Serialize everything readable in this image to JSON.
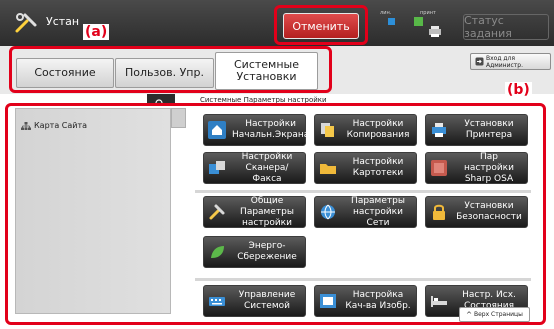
{
  "header": {
    "title": "Устан",
    "cancel_label": "Отменить",
    "status_label_1": "лин.",
    "status_label_2": "принт",
    "job_status_label": "Статус задания"
  },
  "tabs": [
    {
      "label": "Состояние",
      "active": false
    },
    {
      "label": "Пользов. Упр.",
      "active": false
    },
    {
      "label": "Системные Установки",
      "active": true
    }
  ],
  "admin_login_label": "Вход для Администр.",
  "breadcrumb_text": "Системные Параметры настройки",
  "sidebar": {
    "items": [
      {
        "label": "Карта Сайта",
        "icon": "sitemap-icon"
      }
    ]
  },
  "tiles": [
    {
      "label": "Настройки Начальн.Экрана",
      "icon": "home-icon"
    },
    {
      "label": "Настройки Копирования",
      "icon": "copy-icon"
    },
    {
      "label": "Установки Принтера",
      "icon": "printer-icon"
    },
    {
      "label": "Настройки Сканера/Факса",
      "icon": "scanner-fax-icon"
    },
    {
      "label": "Настройки Картотеки",
      "icon": "folder-icon"
    },
    {
      "label": "Пар настройки Sharp OSA",
      "icon": "osa-icon"
    },
    {
      "label": "Общие Параметры настройки",
      "icon": "tools-icon"
    },
    {
      "label": "Параметры настройки Сети",
      "icon": "network-globe-icon"
    },
    {
      "label": "Установки Безопасности",
      "icon": "lock-icon"
    },
    {
      "label": "Энерго-Сбережение",
      "icon": "leaf-icon"
    },
    {
      "label": "Управление Системой",
      "icon": "keyboard-icon"
    },
    {
      "label": "Настройка Кач-ва Изобр.",
      "icon": "image-quality-icon"
    },
    {
      "label": "Настр. Исх. Состояния",
      "icon": "bed-icon"
    }
  ],
  "page_top_label": "Верх Страницы",
  "annotations": [
    {
      "label": "(a)"
    },
    {
      "label": "(b)"
    }
  ],
  "colors": {
    "cancel": "#c62828",
    "annotation": "#e2001a",
    "tile": "#2a2a2a"
  }
}
